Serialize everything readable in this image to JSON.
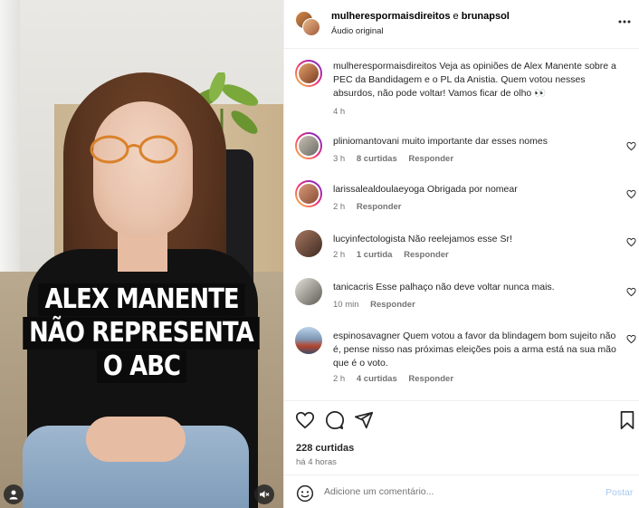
{
  "media": {
    "caption_lines": [
      "ALEX MANENTE",
      "NÃO REPRESENTA",
      "O ABC"
    ],
    "icons": {
      "profile": "user-icon",
      "mute": "speaker-muted-icon"
    }
  },
  "header": {
    "author_1": "mulherespormaisdireitos",
    "joiner": "e",
    "author_2": "brunapsol",
    "audio": "Áudio original",
    "more_icon": "more-horizontal-icon"
  },
  "caption_comment": {
    "user": "mulherespormaisdireitos",
    "text": "Veja as opiniões de Alex Manente sobre a PEC da Bandidagem e o PL da Anistia. Quem votou nesses absurdos, não pode voltar! Vamos ficar de olho 👀",
    "time": "4 h"
  },
  "comments": [
    {
      "user": "pliniomantovani",
      "text": "muito importante dar esses nomes",
      "time": "3 h",
      "likes": "8 curtidas",
      "reply": "Responder"
    },
    {
      "user": "larissalealdoulaeyoga",
      "text": "Obrigada por nomear",
      "time": "2 h",
      "likes": "",
      "reply": "Responder"
    },
    {
      "user": "lucyinfectologista",
      "text": "Não reelejamos esse Sr!",
      "time": "2 h",
      "likes": "1 curtida",
      "reply": "Responder"
    },
    {
      "user": "tanicacris",
      "text": "Esse palhaço não deve voltar nunca mais.",
      "time": "10 min",
      "likes": "",
      "reply": "Responder"
    },
    {
      "user": "espinosavagner",
      "text": "Quem votou a favor da blindagem bom sujeito não é, pense nisso nas próximas eleições pois a arma está na sua mão que é o voto.",
      "time": "2 h",
      "likes": "4 curtidas",
      "reply": "Responder"
    }
  ],
  "actions": {
    "likes": "228 curtidas",
    "posted": "há 4 horas",
    "icons": [
      "heart-icon",
      "comment-icon",
      "share-icon",
      "bookmark-icon"
    ]
  },
  "composer": {
    "placeholder": "Adicione um comentário...",
    "post_label": "Postar"
  },
  "colors": {
    "accent": "#0095f6",
    "post_disabled": "#a8c8f0",
    "secondary_text": "#737373"
  }
}
